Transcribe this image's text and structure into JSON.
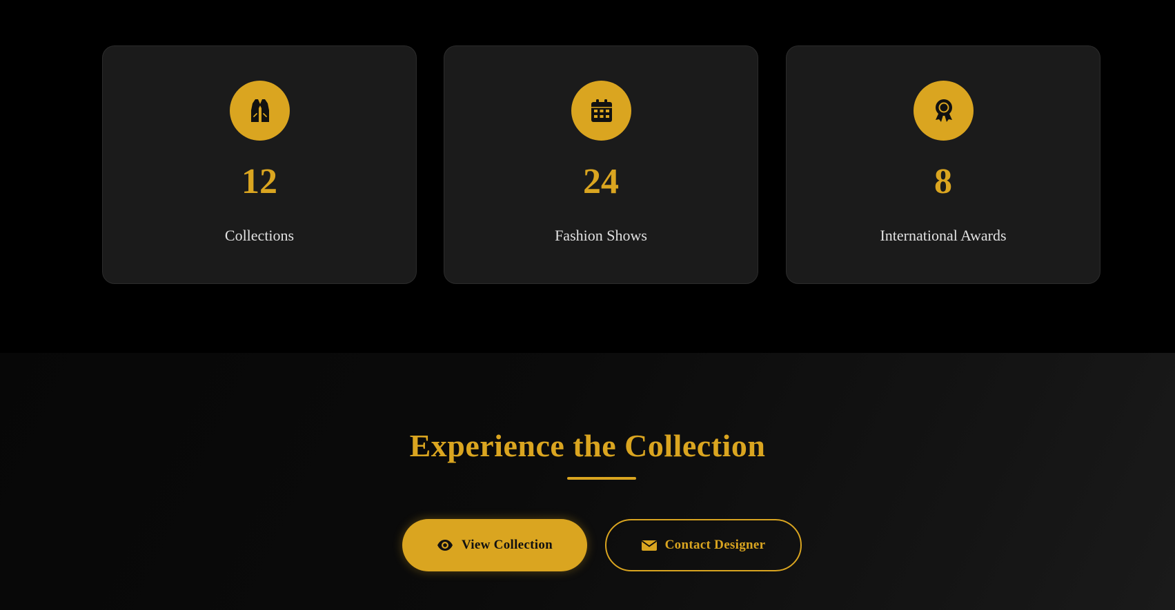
{
  "colors": {
    "accent": "#daa520",
    "card_bg": "#1b1b1b",
    "page_bg": "#000000",
    "label_text": "#e2e2e2"
  },
  "stats": [
    {
      "icon": "vest-icon",
      "number": "12",
      "label": "Collections"
    },
    {
      "icon": "calendar-icon",
      "number": "24",
      "label": "Fashion Shows"
    },
    {
      "icon": "award-icon",
      "number": "8",
      "label": "International Awards"
    }
  ],
  "cta": {
    "title": "Experience the Collection",
    "primary_button": {
      "icon": "eye-icon",
      "label": "View Collection"
    },
    "secondary_button": {
      "icon": "envelope-icon",
      "label": "Contact Designer"
    }
  }
}
